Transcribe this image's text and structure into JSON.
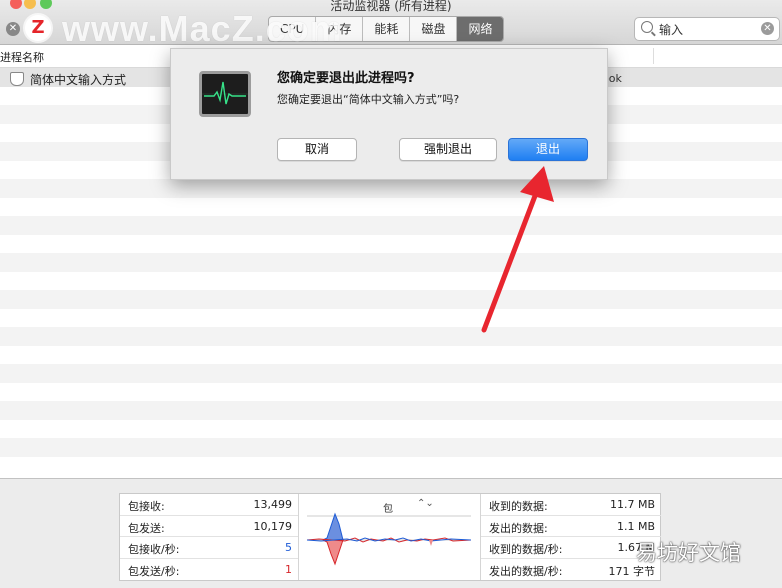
{
  "window": {
    "title": "活动监视器 (所有进程)"
  },
  "watermark": {
    "logo": "Z",
    "text": "www.MacZ.com",
    "corner": "易坊好文馆"
  },
  "toolbar": {
    "tabs": [
      {
        "label": "CPU"
      },
      {
        "label": "内存"
      },
      {
        "label": "能耗"
      },
      {
        "label": "磁盘"
      },
      {
        "label": "网络",
        "active": true
      }
    ],
    "search": {
      "value": "输入"
    }
  },
  "table": {
    "header": {
      "process_name": "进程名称"
    },
    "rows": [
      {
        "name": "简体中文输入方式",
        "right": "ook"
      }
    ]
  },
  "dialog": {
    "title": "您确定要退出此进程吗?",
    "message": "您确定要退出“简体中文输入方式”吗?",
    "cancel": "取消",
    "force_quit": "强制退出",
    "quit": "退出"
  },
  "stats": {
    "left": [
      {
        "label": "包接收:",
        "value": "13,499"
      },
      {
        "label": "包发送:",
        "value": "10,179"
      },
      {
        "label": "包接收/秒:",
        "value": "5",
        "color": "#1d5bd6"
      },
      {
        "label": "包发送/秒:",
        "value": "1",
        "color": "#d6262b"
      }
    ],
    "graph_title": "包",
    "right": [
      {
        "label": "收到的数据:",
        "value": "11.7 MB"
      },
      {
        "label": "发出的数据:",
        "value": "1.1 MB"
      },
      {
        "label": "收到的数据/秒:",
        "value": "1.67 M"
      },
      {
        "label": "发出的数据/秒:",
        "value": "171 字节"
      }
    ]
  },
  "colors": {
    "accent": "#1f7ff2",
    "received": "#1d5bd6",
    "sent": "#d6262b",
    "arrow": "#e8262f"
  }
}
